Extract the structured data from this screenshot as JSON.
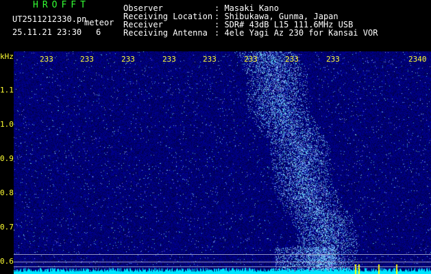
{
  "header": {
    "brand": "HROFFT",
    "filename": "UT2511212330.pn",
    "kind": "meteor",
    "date_time": "25.11.21 23:30",
    "count": "6",
    "fields": [
      {
        "label": "Observer",
        "value": ": Masaki Kano"
      },
      {
        "label": "Receiving Location",
        "value": ": Shibukawa, Gunma, Japan"
      },
      {
        "label": "Receiver",
        "value": ": SDR# 43dB L15 111.6MHz USB"
      },
      {
        "label": "Receiving Antenna",
        "value": ": 4ele Yagi Az 230 for Kansai VOR"
      }
    ]
  },
  "axes": {
    "y_unit": "kHz",
    "y_ticks": [
      "1.1",
      "1.0",
      "0.9",
      "0.8",
      "0.7",
      "0.6"
    ],
    "x_ticks": [
      "233",
      "233",
      "233",
      "233",
      "233",
      "233",
      "233",
      "233",
      "2340"
    ]
  },
  "colors": {
    "background": "#000000",
    "plot_base": "#06066a",
    "label_yellow": "#ffff33",
    "brand_green": "#33ff33",
    "trace_cyan": "#00e5ff"
  }
}
